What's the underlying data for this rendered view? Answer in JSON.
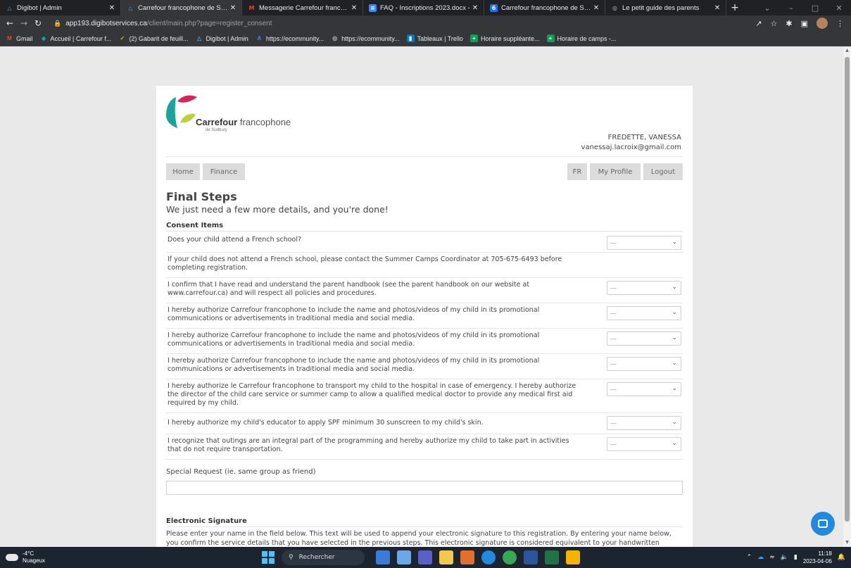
{
  "browser": {
    "tabs": [
      {
        "title": "Digibot | Admin",
        "icon": "digibot-icon",
        "active": false
      },
      {
        "title": "Carrefour francophone de Sudb",
        "icon": "digibot-icon",
        "active": true
      },
      {
        "title": "Messagerie Carrefour francoph",
        "icon": "gmail-icon",
        "active": false
      },
      {
        "title": "FAQ - Inscriptions 2023.docx -",
        "icon": "docs-icon",
        "active": false
      },
      {
        "title": "Carrefour francophone de Sudb",
        "icon": "calendar-icon",
        "active": false
      },
      {
        "title": "Le petit guide des parents",
        "icon": "globe-icon",
        "active": false
      }
    ],
    "url_host": "app193.digibotservices.ca",
    "url_path": "/client/main.php?page=register_consent",
    "bookmarks": [
      {
        "label": "Gmail",
        "icon": "gmail-icon"
      },
      {
        "label": "Accueil | Carrefour f...",
        "icon": "carrefour-icon"
      },
      {
        "label": "(2) Gabarit de feuill...",
        "icon": "check-icon"
      },
      {
        "label": "Digibot | Admin",
        "icon": "digibot-icon"
      },
      {
        "label": "https://ecommunity...",
        "icon": "a-icon"
      },
      {
        "label": "https://ecommunity...",
        "icon": "globe-icon"
      },
      {
        "label": "Tableaux | Trello",
        "icon": "trello-icon"
      },
      {
        "label": "Horaire suppléante...",
        "icon": "sheets-icon"
      },
      {
        "label": "Horaire de camps -...",
        "icon": "sheets-icon"
      }
    ]
  },
  "header": {
    "brand_bold": "Carrefour",
    "brand_rest": "francophone",
    "brand_sub": "de Sudbury",
    "user_name": "FREDETTE, VANESSA",
    "user_email": "vanessaj.lacroix@gmail.com",
    "nav": {
      "home": "Home",
      "finance": "Finance",
      "lang": "FR",
      "profile": "My Profile",
      "logout": "Logout"
    }
  },
  "form": {
    "title": "Final Steps",
    "subtitle": "We just need a few more details, and you're done!",
    "consent_heading": "Consent Items",
    "select_placeholder": "---",
    "items": [
      {
        "text": "Does your child attend a French school?",
        "has_select": true
      },
      {
        "text": "If your child does not attend a French school, please contact the Summer Camps Coordinator at 705-675-6493 before completing registration.",
        "has_select": false
      },
      {
        "text": "I confirm that I have read and understand the parent handbook (see the parent handbook on our website at www.carrefour.ca) and will respect all policies and procedures.",
        "has_select": true
      },
      {
        "text": "I hereby authorize Carrefour francophone to include the name and photos/videos of my child in its promotional communications or advertisements in traditional media and social media.",
        "has_select": true
      },
      {
        "text": "I hereby authorize Carrefour francophone to include the name and photos/videos of my child in its promotional communications or advertisements in traditional media and social media.",
        "has_select": true
      },
      {
        "text": "I hereby authorize Carrefour francophone to include the name and photos/videos of my child in its promotional communications or advertisements in traditional media and social media.",
        "has_select": true
      },
      {
        "text": "I hereby authorize le Carrefour francophone to transport my child to the hospital in case of emergency. I hereby authorize the director of the child care service or summer camp to allow a qualified medical doctor to provide any medical first aid required by my child.",
        "has_select": true
      },
      {
        "text": "I hereby authorize my child's educator to apply SPF minimum 30 sunscreen to my child's skin.",
        "has_select": true
      },
      {
        "text": "I recognize that outings are an integral part of the programming and hereby authorize my child to take part in activities that do not require transportation.",
        "has_select": true
      }
    ],
    "special_request_label": "Special Request (ie. same group as friend)",
    "signature_heading": "Electronic Signature",
    "signature_text": "Please enter your name in the field below. This text will be used to append your electronic signature to this registration. By entering your name below, you confirm the service details that you have selected in the previous steps. This electronic signature is considered equivalent to your handwritten"
  },
  "taskbar": {
    "temperature": "-4°C",
    "weather": "Nuageux",
    "search": "Rechercher",
    "time": "11:18",
    "date": "2023-04-06"
  },
  "colors": {
    "accent": "#1f8ae0",
    "logo_teal": "#1aa39a",
    "logo_pink": "#d6245a",
    "logo_green": "#b9d33a"
  }
}
